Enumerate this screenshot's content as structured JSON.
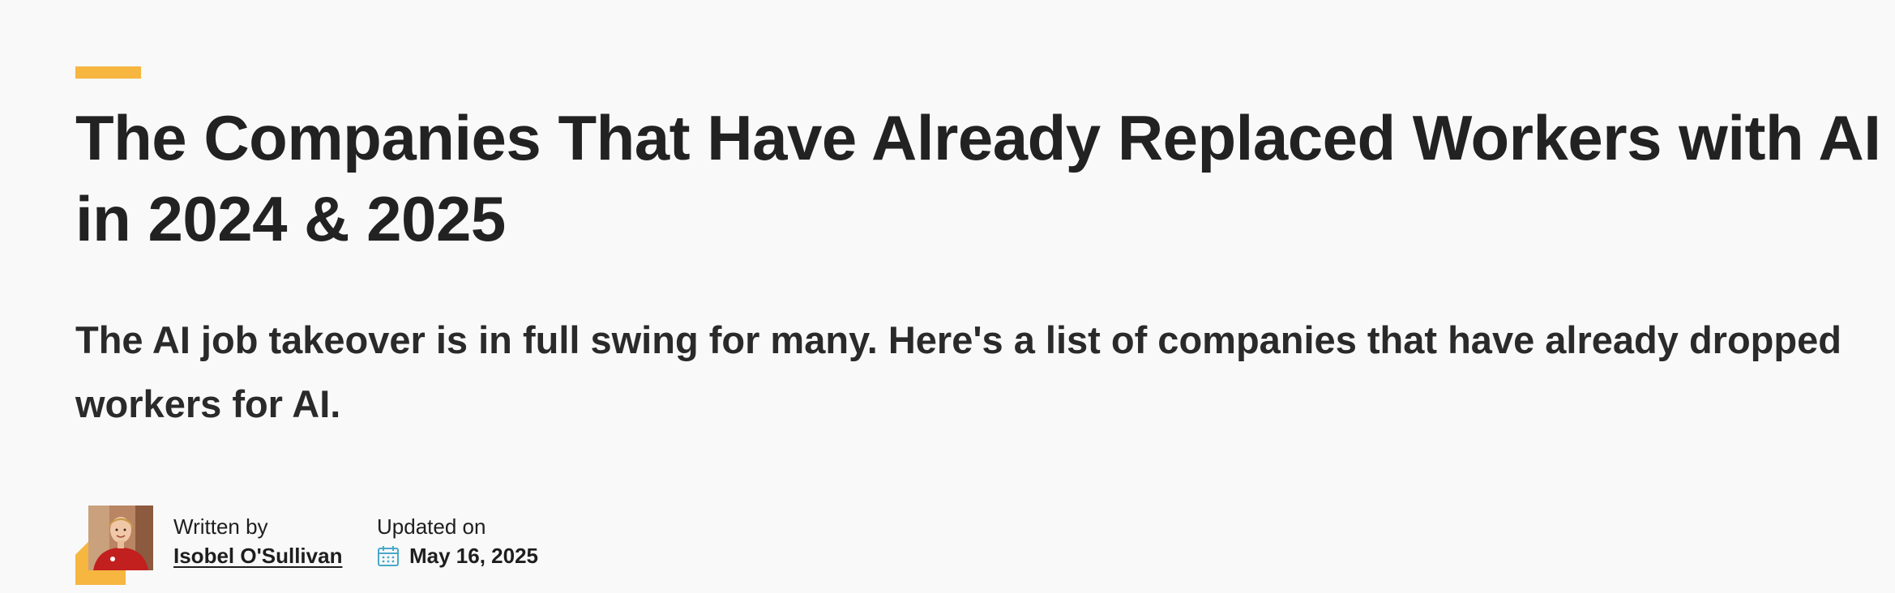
{
  "article": {
    "title": "The Companies That Have Already Replaced Workers with AI in 2024 & 2025",
    "subtitle": "The AI job takeover is in full swing for many. Here's a list of companies that have already dropped workers for AI."
  },
  "meta": {
    "written_by_label": "Written by",
    "author_name": "Isobel O'Sullivan",
    "updated_label": "Updated on",
    "updated_date": "May 16, 2025"
  },
  "icons": {
    "calendar": "calendar-icon",
    "avatar": "author-avatar"
  },
  "colors": {
    "accent": "#f6b63f",
    "text": "#222222",
    "background": "#f9f9f9",
    "calendar_icon": "#4aa8c9"
  }
}
